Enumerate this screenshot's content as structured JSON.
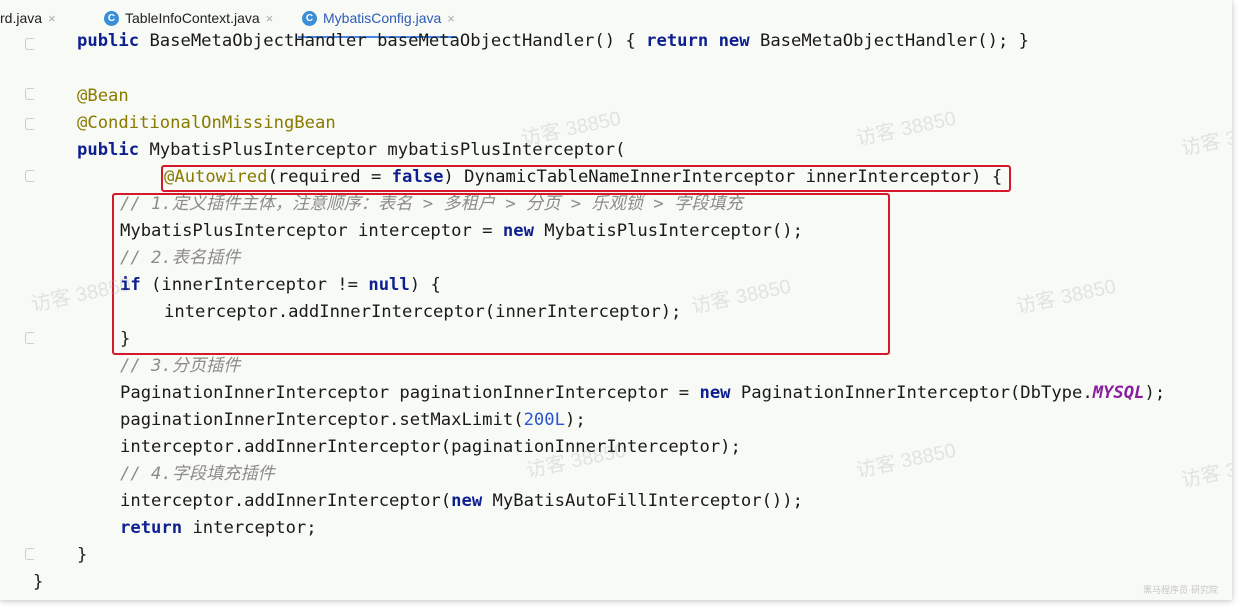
{
  "tabs": [
    {
      "label": "rd.java",
      "active": false,
      "icon": "none"
    },
    {
      "label": "TableInfoContext.java",
      "active": false,
      "icon": "class-icon"
    },
    {
      "label": "MybatisConfig.java",
      "active": true,
      "icon": "class-icon"
    }
  ],
  "tab_close_glyph": "×",
  "class_icon_letter": "C",
  "code": {
    "line0": {
      "a": "public ",
      "b": "BaseMetaObjectHandler baseMetaObjectHandler() { ",
      "c": "return ",
      "d": "new ",
      "e": "BaseMetaObjectHandler(); }"
    },
    "line2": "@Bean",
    "line3": "@ConditionalOnMissingBean",
    "line4": {
      "a": "public ",
      "b": "MybatisPlusInterceptor mybatisPlusInterceptor("
    },
    "line5": {
      "a": "@Autowired",
      "b": "(required = ",
      "c": "false",
      "d": ") DynamicTableNameInnerInterceptor innerInterceptor",
      "e": ") {"
    },
    "line6": "// 1.定义插件主体，注意顺序：表名 > 多租户 > 分页 > 乐观锁 > 字段填充",
    "line7": {
      "a": "MybatisPlusInterceptor interceptor = ",
      "b": "new ",
      "c": "MybatisPlusInterceptor();"
    },
    "line8": "// 2.表名插件",
    "line9": {
      "a": "if ",
      "b": "(innerInterceptor != ",
      "c": "null",
      "d": ") {"
    },
    "line10": "interceptor.addInnerInterceptor(innerInterceptor);",
    "line11": "}",
    "line12": "// 3.分页插件",
    "line13": {
      "a": "PaginationInnerInterceptor paginationInnerInterceptor = ",
      "b": "new ",
      "c": "PaginationInnerInterceptor(DbType.",
      "d": "MYSQL",
      "e": ");"
    },
    "line14": {
      "a": "paginationInnerInterceptor.setMaxLimit(",
      "b": "200L",
      "c": ");"
    },
    "line15": "interceptor.addInnerInterceptor(paginationInnerInterceptor);",
    "line16": "// 4.字段填充插件",
    "line17": {
      "a": "interceptor.addInnerInterceptor(",
      "b": "new ",
      "c": "MyBatisAutoFillInterceptor());"
    },
    "line18": {
      "a": "return ",
      "b": "interceptor;"
    },
    "line19": "}",
    "line20": "}"
  },
  "watermark": "访客 38850",
  "corner_watermark": "黑马程序员·研究院",
  "colors": {
    "keyword": "#0e1f8f",
    "annotation": "#8a7a00",
    "comment": "#8c8c8c",
    "number": "#2a55d0",
    "highlight_box": "#d6182b"
  }
}
